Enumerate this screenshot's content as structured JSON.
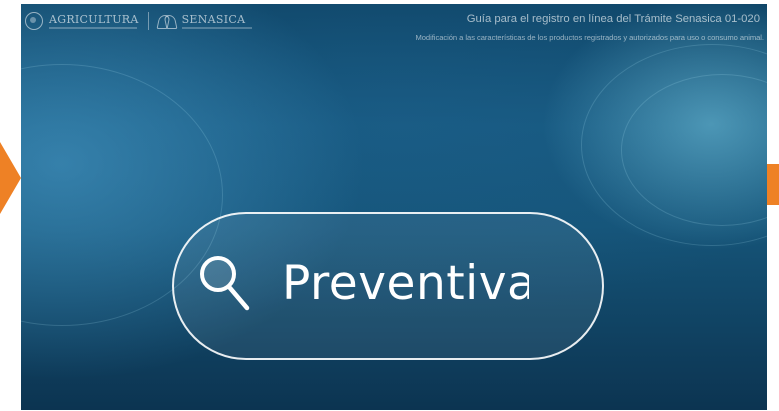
{
  "header": {
    "logo_primary": "AGRICULTURA",
    "logo_secondary": "SENASICA",
    "title": "Guía para el registro en línea del Trámite Senasica 01-020",
    "subtitle": "Modificación a las características de los productos registrados y autorizados para uso o consumo animal."
  },
  "search": {
    "icon": "search-icon",
    "typed_text": "Preventiva"
  },
  "colors": {
    "accent": "#ee8125",
    "background_dark": "#0f4668",
    "text": "#ffffff"
  }
}
